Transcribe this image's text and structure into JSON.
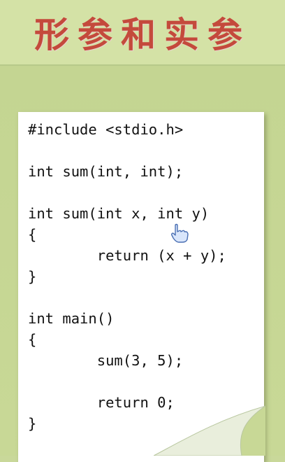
{
  "slide": {
    "title": "形参和实参"
  },
  "code_lines": [
    "#include <stdio.h>",
    "",
    "int sum(int, int);",
    "",
    "int sum(int x, int y)",
    "{",
    "        return (x + y);",
    "}",
    "",
    "int main()",
    "{",
    "        sum(3, 5);",
    "",
    "        return 0;",
    "}"
  ],
  "colors": {
    "title": "#c44a3c",
    "background": "#c9d89a",
    "paper": "#ffffff"
  },
  "icons": {
    "pointer": "hand-pointer-icon"
  }
}
